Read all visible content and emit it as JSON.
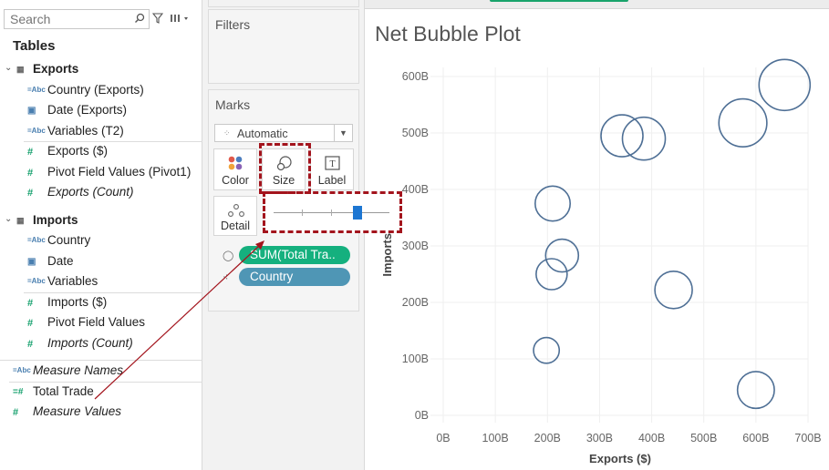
{
  "search": {
    "placeholder": "Search"
  },
  "data_pane": {
    "title": "Tables",
    "tables": [
      {
        "name": "Exports",
        "fields": [
          {
            "icon": "Abc",
            "label": "Country (Exports)",
            "italic": false
          },
          {
            "icon": "date",
            "label": "Date (Exports)",
            "italic": false
          },
          {
            "icon": "Abc",
            "label": "Variables (T2)",
            "italic": false
          },
          {
            "icon": "measure",
            "label": "Exports ($)",
            "italic": false
          },
          {
            "icon": "measure",
            "label": "Pivot Field Values (Pivot1)",
            "italic": false
          },
          {
            "icon": "measure",
            "label": "Exports (Count)",
            "italic": true
          }
        ]
      },
      {
        "name": "Imports",
        "fields": [
          {
            "icon": "Abc",
            "label": "Country",
            "italic": false
          },
          {
            "icon": "date",
            "label": "Date",
            "italic": false
          },
          {
            "icon": "Abc",
            "label": "Variables",
            "italic": false
          },
          {
            "icon": "measure",
            "label": "Imports ($)",
            "italic": false
          },
          {
            "icon": "measure",
            "label": "Pivot Field Values",
            "italic": false
          },
          {
            "icon": "measure",
            "label": "Imports (Count)",
            "italic": true
          }
        ]
      }
    ],
    "extra_fields": [
      {
        "icon": "Abc",
        "label": "Measure Names",
        "italic": true
      },
      {
        "icon": "calc",
        "label": "Total Trade",
        "italic": false
      },
      {
        "icon": "measure",
        "label": "Measure Values",
        "italic": true
      }
    ]
  },
  "cards": {
    "filters_title": "Filters",
    "marks_title": "Marks",
    "mark_type": "Automatic",
    "buttons": {
      "color": "Color",
      "size": "Size",
      "label": "Label",
      "detail": "Detail"
    },
    "pills": [
      {
        "label": "SUM(Total Tra..",
        "color": "#15b07e",
        "icon": "size"
      },
      {
        "label": "Country",
        "color": "#4f96b5",
        "icon": "detail"
      }
    ]
  },
  "colors": {
    "bubble_stroke": "#4e6f95",
    "highlight": "#a3141d",
    "slider_thumb": "#1d76d2"
  },
  "chart_data": {
    "type": "scatter",
    "title": "Net Bubble Plot",
    "xlabel": "Exports ($)",
    "ylabel": "Imports ($)",
    "x_ticks": [
      "0B",
      "100B",
      "200B",
      "300B",
      "400B",
      "500B",
      "600B",
      "700B"
    ],
    "y_ticks": [
      "0B",
      "100B",
      "200B",
      "300B",
      "400B",
      "500B",
      "600B"
    ],
    "xlim": [
      0,
      700
    ],
    "ylim": [
      0,
      600
    ],
    "grid": true,
    "size_by": "SUM(Total Trade)",
    "points": [
      {
        "x": 655,
        "y": 585,
        "size": 1240
      },
      {
        "x": 575,
        "y": 518,
        "size": 1093
      },
      {
        "x": 343,
        "y": 495,
        "size": 838
      },
      {
        "x": 385,
        "y": 490,
        "size": 875
      },
      {
        "x": 210,
        "y": 375,
        "size": 585
      },
      {
        "x": 228,
        "y": 283,
        "size": 511
      },
      {
        "x": 208,
        "y": 250,
        "size": 458
      },
      {
        "x": 442,
        "y": 222,
        "size": 664
      },
      {
        "x": 198,
        "y": 115,
        "size": 313
      },
      {
        "x": 600,
        "y": 45,
        "size": 645
      }
    ]
  }
}
